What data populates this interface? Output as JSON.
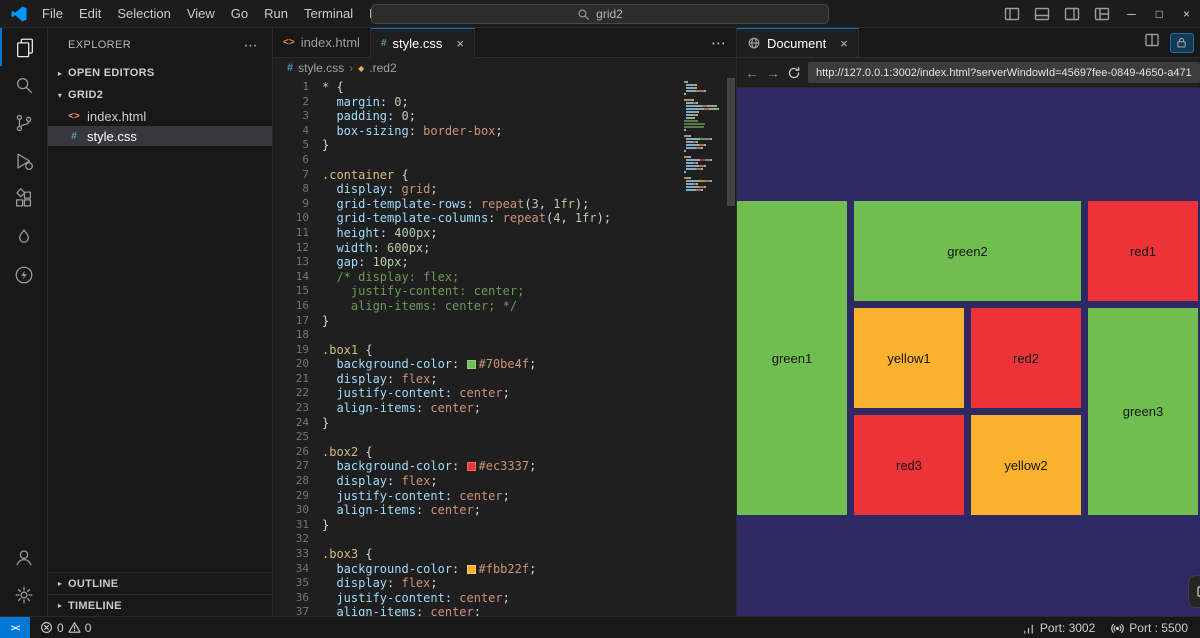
{
  "icons": {
    "ellipsis": "⋯",
    "chevron_right": "▸",
    "chevron_down": "▾",
    "breadcrumb_sep": "›",
    "symbol_class": "◆",
    "close": "×",
    "minimize": "─",
    "maximize": "□",
    "back": "←",
    "forward": "→",
    "remote_glyph": "><"
  },
  "colors": {
    "accent": "#0078d4",
    "tokens": {
      "s": "#d7ba7d",
      "p": "#9cdcfe",
      "v": "#ce9178",
      "n": "#b5cea8",
      "t": "#d4d4d4",
      "c": "#6a9955"
    }
  },
  "titlebar": {
    "menus": [
      "File",
      "Edit",
      "Selection",
      "View",
      "Go",
      "Run",
      "Terminal",
      "Help"
    ],
    "search_value": "grid2"
  },
  "sidebar": {
    "title": "EXPLORER",
    "open_editors_label": "OPEN EDITORS",
    "folder_label": "GRID2",
    "files": [
      {
        "label": "index.html",
        "icon_glyph": "<>",
        "icon_color": "#e8824a",
        "selected": false
      },
      {
        "label": "style.css",
        "icon_glyph": "#",
        "icon_color": "#519aba",
        "selected": true
      }
    ],
    "outline_label": "OUTLINE",
    "timeline_label": "TIMELINE"
  },
  "editor": {
    "tabs": [
      {
        "label": "index.html",
        "icon_glyph": "<>",
        "icon_color": "#e8824a",
        "active": false
      },
      {
        "label": "style.css",
        "icon_glyph": "#",
        "icon_color": "#519aba",
        "active": true
      }
    ],
    "breadcrumb": [
      "style.css",
      ".red2"
    ],
    "code_lines": [
      [
        [
          "s",
          "* "
        ],
        [
          "t",
          "{"
        ]
      ],
      [
        [
          "t",
          "  "
        ],
        [
          "p",
          "margin"
        ],
        [
          "t",
          ": "
        ],
        [
          "n",
          "0"
        ],
        [
          "t",
          ";"
        ]
      ],
      [
        [
          "t",
          "  "
        ],
        [
          "p",
          "padding"
        ],
        [
          "t",
          ": "
        ],
        [
          "n",
          "0"
        ],
        [
          "t",
          ";"
        ]
      ],
      [
        [
          "t",
          "  "
        ],
        [
          "p",
          "box-sizing"
        ],
        [
          "t",
          ": "
        ],
        [
          "v",
          "border-box"
        ],
        [
          "t",
          ";"
        ]
      ],
      [
        [
          "t",
          "}"
        ]
      ],
      [],
      [
        [
          "s",
          ".container "
        ],
        [
          "t",
          "{"
        ]
      ],
      [
        [
          "t",
          "  "
        ],
        [
          "p",
          "display"
        ],
        [
          "t",
          ": "
        ],
        [
          "v",
          "grid"
        ],
        [
          "t",
          ";"
        ]
      ],
      [
        [
          "t",
          "  "
        ],
        [
          "p",
          "grid-template-rows"
        ],
        [
          "t",
          ": "
        ],
        [
          "v",
          "repeat"
        ],
        [
          "t",
          "("
        ],
        [
          "n",
          "3"
        ],
        [
          "t",
          ", "
        ],
        [
          "n",
          "1fr"
        ],
        [
          "t",
          ");"
        ]
      ],
      [
        [
          "t",
          "  "
        ],
        [
          "p",
          "grid-template-columns"
        ],
        [
          "t",
          ": "
        ],
        [
          "v",
          "repeat"
        ],
        [
          "t",
          "("
        ],
        [
          "n",
          "4"
        ],
        [
          "t",
          ", "
        ],
        [
          "n",
          "1fr"
        ],
        [
          "t",
          ");"
        ]
      ],
      [
        [
          "t",
          "  "
        ],
        [
          "p",
          "height"
        ],
        [
          "t",
          ": "
        ],
        [
          "n",
          "400px"
        ],
        [
          "t",
          ";"
        ]
      ],
      [
        [
          "t",
          "  "
        ],
        [
          "p",
          "width"
        ],
        [
          "t",
          ": "
        ],
        [
          "n",
          "600px"
        ],
        [
          "t",
          ";"
        ]
      ],
      [
        [
          "t",
          "  "
        ],
        [
          "p",
          "gap"
        ],
        [
          "t",
          ": "
        ],
        [
          "n",
          "10px"
        ],
        [
          "t",
          ";"
        ]
      ],
      [
        [
          "c",
          "  /* display: flex;"
        ]
      ],
      [
        [
          "c",
          "    justify-content: center;"
        ]
      ],
      [
        [
          "c",
          "    align-items: center; */"
        ]
      ],
      [
        [
          "t",
          "}"
        ]
      ],
      [],
      [
        [
          "s",
          ".box1 "
        ],
        [
          "t",
          "{"
        ]
      ],
      [
        [
          "t",
          "  "
        ],
        [
          "p",
          "background-color"
        ],
        [
          "t",
          ": "
        ],
        [
          "w",
          "#70be4f"
        ],
        [
          "v",
          "#70be4f"
        ],
        [
          "t",
          ";"
        ]
      ],
      [
        [
          "t",
          "  "
        ],
        [
          "p",
          "display"
        ],
        [
          "t",
          ": "
        ],
        [
          "v",
          "flex"
        ],
        [
          "t",
          ";"
        ]
      ],
      [
        [
          "t",
          "  "
        ],
        [
          "p",
          "justify-content"
        ],
        [
          "t",
          ": "
        ],
        [
          "v",
          "center"
        ],
        [
          "t",
          ";"
        ]
      ],
      [
        [
          "t",
          "  "
        ],
        [
          "p",
          "align-items"
        ],
        [
          "t",
          ": "
        ],
        [
          "v",
          "center"
        ],
        [
          "t",
          ";"
        ]
      ],
      [
        [
          "t",
          "}"
        ]
      ],
      [],
      [
        [
          "s",
          ".box2 "
        ],
        [
          "t",
          "{"
        ]
      ],
      [
        [
          "t",
          "  "
        ],
        [
          "p",
          "background-color"
        ],
        [
          "t",
          ": "
        ],
        [
          "w",
          "#ec3337"
        ],
        [
          "v",
          "#ec3337"
        ],
        [
          "t",
          ";"
        ]
      ],
      [
        [
          "t",
          "  "
        ],
        [
          "p",
          "display"
        ],
        [
          "t",
          ": "
        ],
        [
          "v",
          "flex"
        ],
        [
          "t",
          ";"
        ]
      ],
      [
        [
          "t",
          "  "
        ],
        [
          "p",
          "justify-content"
        ],
        [
          "t",
          ": "
        ],
        [
          "v",
          "center"
        ],
        [
          "t",
          ";"
        ]
      ],
      [
        [
          "t",
          "  "
        ],
        [
          "p",
          "align-items"
        ],
        [
          "t",
          ": "
        ],
        [
          "v",
          "center"
        ],
        [
          "t",
          ";"
        ]
      ],
      [
        [
          "t",
          "}"
        ]
      ],
      [],
      [
        [
          "s",
          ".box3 "
        ],
        [
          "t",
          "{"
        ]
      ],
      [
        [
          "t",
          "  "
        ],
        [
          "p",
          "background-color"
        ],
        [
          "t",
          ": "
        ],
        [
          "w",
          "#fbb22f"
        ],
        [
          "v",
          "#fbb22f"
        ],
        [
          "t",
          ";"
        ]
      ],
      [
        [
          "t",
          "  "
        ],
        [
          "p",
          "display"
        ],
        [
          "t",
          ": "
        ],
        [
          "v",
          "flex"
        ],
        [
          "t",
          ";"
        ]
      ],
      [
        [
          "t",
          "  "
        ],
        [
          "p",
          "justify-content"
        ],
        [
          "t",
          ": "
        ],
        [
          "v",
          "center"
        ],
        [
          "t",
          ";"
        ]
      ],
      [
        [
          "t",
          "  "
        ],
        [
          "p",
          "align-items"
        ],
        [
          "t",
          ": "
        ],
        [
          "v",
          "center"
        ],
        [
          "t",
          ";"
        ]
      ]
    ]
  },
  "browser": {
    "tab_label": "Document",
    "url": "http://127.0.0.1:3002/index.html?serverWindowId=45697fee-0849-4650-a471",
    "page": {
      "background": "#2e2963",
      "boxes": [
        {
          "label": "green1",
          "color": "#70be4f",
          "column": "1",
          "row": "1 / 4"
        },
        {
          "label": "green2",
          "color": "#70be4f",
          "column": "2 / 4",
          "row": "1"
        },
        {
          "label": "red1",
          "color": "#ec3337",
          "column": "4",
          "row": "1"
        },
        {
          "label": "yellow1",
          "color": "#fbb22f",
          "column": "2",
          "row": "2"
        },
        {
          "label": "red2",
          "color": "#ec3337",
          "column": "3",
          "row": "2"
        },
        {
          "label": "green3",
          "color": "#70be4f",
          "column": "4",
          "row": "2 / 4"
        },
        {
          "label": "red3",
          "color": "#ec3337",
          "column": "2",
          "row": "3"
        },
        {
          "label": "yellow2",
          "color": "#fbb22f",
          "column": "3",
          "row": "3"
        }
      ]
    }
  },
  "statusbar": {
    "errors": "0",
    "warnings": "0",
    "port_forward": "Port: 3002",
    "live_server": "Port : 5500"
  }
}
